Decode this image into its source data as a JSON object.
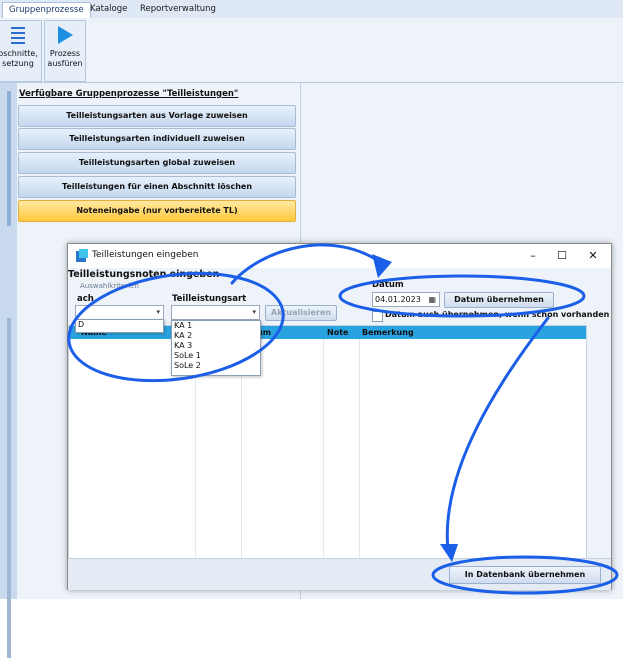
{
  "ribbon": {
    "tabs": [
      "Gruppenprozesse",
      "Kataloge",
      "Reportverwaltung"
    ],
    "buttons": [
      {
        "label1": "bschnitte,",
        "label2": "setzung"
      },
      {
        "label1": "Prozess",
        "label2": "ausfüren"
      }
    ]
  },
  "group_processes": {
    "title": "Verfügbare Gruppenprozesse \"Teilleistungen\"",
    "items": [
      "Teilleistungsarten aus Vorlage zuweisen",
      "Teilleistungsarten individuell zuweisen",
      "Teilleistungsarten global zuweisen",
      "Teilleistungen für einen Abschnitt löschen",
      "Noteneingabe (nur vorbereitete TL)"
    ]
  },
  "dialog": {
    "title": "Teilleistungen eingeben",
    "heading": "Teilleistungsnoten eingeben",
    "filter_caption": "Auswahlkriterien",
    "fach_label": "ach",
    "fach_value": "",
    "tlart_label": "Teilleistungsart",
    "tlart_value": "",
    "refresh_button": "Aktualisieren",
    "datum_label": "Datum",
    "datum_value": "04.01.2023",
    "datum_button": "Datum übernehmen",
    "datum_checkbox": "Datum auch übernehmen, wenn schon vorhanden",
    "columns": [
      "Name",
      "um",
      "Note",
      "Bemerkung"
    ],
    "fach_dropdown": [
      "D"
    ],
    "tlart_dropdown": [
      "KA 1",
      "KA 2",
      "KA 3",
      "SoLe 1",
      "SoLe 2"
    ],
    "save_button": "In Datenbank übernehmen"
  },
  "colors": {
    "accent": "#29a3df",
    "annotation": "#1b5fe8",
    "active_process": "#ffc83d"
  }
}
